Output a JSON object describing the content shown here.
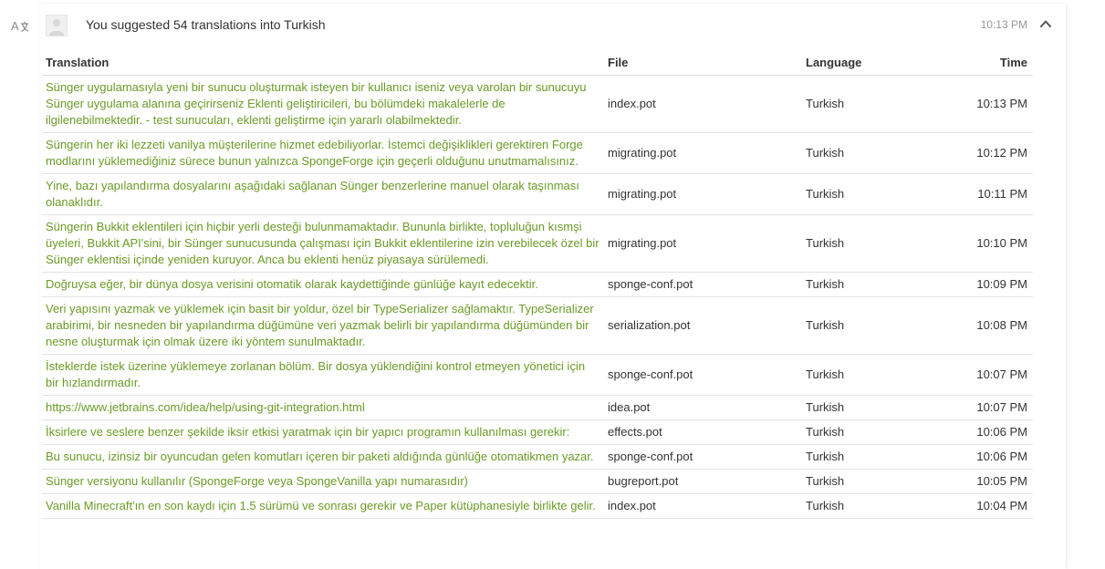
{
  "activity": {
    "title": "You suggested 54 translations into Turkish",
    "time": "10:13 PM",
    "icon": "translate-icon",
    "collapse_icon": "chevron-up-icon"
  },
  "table": {
    "headers": {
      "translation": "Translation",
      "file": "File",
      "language": "Language",
      "time": "Time"
    },
    "rows": [
      {
        "translation": "Sünger uygulamasıyla yeni bir sunucu oluşturmak isteyen bir kullanıcı iseniz veya varolan bir sunucuyu Sünger uygulama alanına geçirirseniz Eklenti geliştiricileri, bu bölümdeki makalelerle de ilgilenebilmektedir. - test sunucuları, eklenti geliştirme için yararlı olabilmektedir.",
        "file": "index.pot",
        "language": "Turkish",
        "time": "10:13 PM"
      },
      {
        "translation": "Süngerin her iki lezzeti vanilya müşterilerine hizmet edebiliyorlar. İstemci değişiklikleri gerektiren Forge modlarını yüklemediğiniz sürece bunun yalnızca SpongeForge için geçerli olduğunu unutmamalısınız.",
        "file": "migrating.pot",
        "language": "Turkish",
        "time": "10:12 PM"
      },
      {
        "translation": "Yine, bazı yapılandırma dosyalarını aşağıdaki sağlanan Sünger benzerlerine manuel olarak taşınması olanaklıdır.",
        "file": "migrating.pot",
        "language": "Turkish",
        "time": "10:11 PM"
      },
      {
        "translation": "Süngerin Bukkit eklentileri için hiçbir yerli desteği bulunmamaktadır. Bununla birlikte, topluluğun kısmşi üyeleri, Bukkit API'sini, bir Sünger sunucusunda çalışması için Bukkit eklentilerine izin verebilecek özel bir Sünger eklentisi içinde yeniden kuruyor. Anca bu eklenti henüz piyasaya sürülemedi.",
        "file": "migrating.pot",
        "language": "Turkish",
        "time": "10:10 PM"
      },
      {
        "translation": "Doğruysa eğer, bir dünya dosya verisini otomatik olarak kaydettiğinde günlüğe kayıt edecektir.",
        "file": "sponge-conf.pot",
        "language": "Turkish",
        "time": "10:09 PM"
      },
      {
        "translation": "Veri yapısını yazmak ve yüklemek için basit bir yoldur, özel bir TypeSerializer sağlamaktır. TypeSerializer arabirimi, bir nesneden bir yapılandırma düğümüne veri yazmak belirli bir yapılandırma düğümünden bir nesne oluşturmak için olmak üzere iki yöntem sunulmaktadır.",
        "file": "serialization.pot",
        "language": "Turkish",
        "time": "10:08 PM"
      },
      {
        "translation": "İsteklerde istek üzerine yüklemeye zorlanan bölüm. Bir dosya yüklendiğini kontrol etmeyen yönetici için bir hızlandırmadır.",
        "file": "sponge-conf.pot",
        "language": "Turkish",
        "time": "10:07 PM"
      },
      {
        "translation": "https://www.jetbrains.com/idea/help/using-git-integration.html",
        "file": "idea.pot",
        "language": "Turkish",
        "time": "10:07 PM"
      },
      {
        "translation": "İksirlere ve seslere benzer şekilde iksir etkisi yaratmak için bir yapıcı programın kullanılması gerekir:",
        "file": "effects.pot",
        "language": "Turkish",
        "time": "10:06 PM"
      },
      {
        "translation": "Bu sunucu, izinsiz bir oyuncudan gelen komutları içeren bir paketi aldığında günlüğe otomatikmen yazar.",
        "file": "sponge-conf.pot",
        "language": "Turkish",
        "time": "10:06 PM"
      },
      {
        "translation": "Sünger versiyonu kullanılır (SpongeForge veya SpongeVanilla yapı numarasıdır)",
        "file": "bugreport.pot",
        "language": "Turkish",
        "time": "10:05 PM"
      },
      {
        "translation": "Vanilla Minecraft'ın en son kaydı için 1.5 sürümü ve sonrası gerekir ve Paper kütüphanesiyle birlikte gelir.",
        "file": "index.pot",
        "language": "Turkish",
        "time": "10:04 PM"
      }
    ]
  }
}
